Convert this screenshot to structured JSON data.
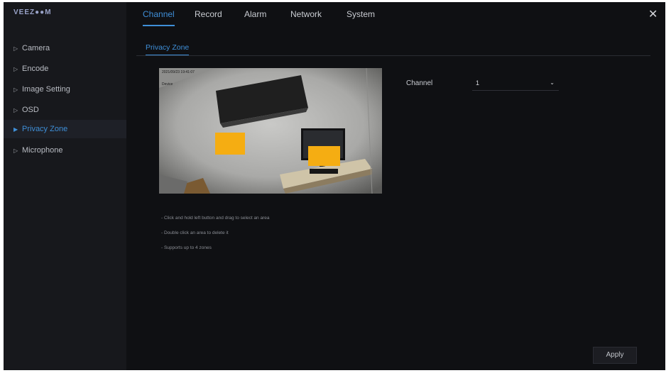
{
  "brand": {
    "logo_text": "VEEZ●●M"
  },
  "sidebar": {
    "items": [
      {
        "label": "Camera",
        "active": false
      },
      {
        "label": "Encode",
        "active": false
      },
      {
        "label": "Image Setting",
        "active": false
      },
      {
        "label": "OSD",
        "active": false
      },
      {
        "label": "Privacy Zone",
        "active": true
      },
      {
        "label": "Microphone",
        "active": false
      }
    ]
  },
  "header": {
    "tabs": [
      {
        "label": "Channel",
        "active": true
      },
      {
        "label": "Record",
        "active": false
      },
      {
        "label": "Alarm",
        "active": false
      },
      {
        "label": "Network",
        "active": false
      },
      {
        "label": "System",
        "active": false
      }
    ],
    "close_symbol": "✕"
  },
  "page": {
    "subtab": "Privacy Zone",
    "preview": {
      "osd_time": "2021/09/23 19:41:07",
      "osd_name": "Device"
    },
    "hints": [
      "- Click and hold left button and drag to select an area",
      "- Double click an area to delete it",
      "- Supports up to 4 zones"
    ],
    "channel": {
      "label": "Channel",
      "value": "1"
    },
    "apply_label": "Apply"
  },
  "colors": {
    "accent": "#3f8fd8",
    "background": "#0f1013",
    "sidebar": "#17181c",
    "zone": "#f5ad12"
  }
}
